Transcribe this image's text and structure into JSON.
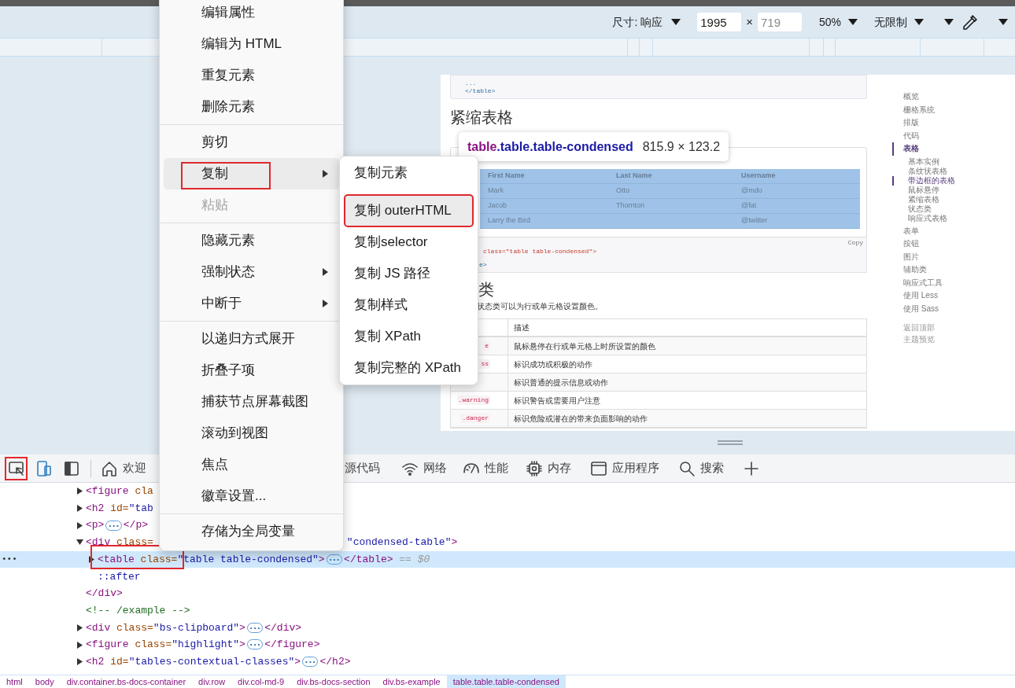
{
  "device_toolbar": {
    "dimensions": "尺寸: 响应",
    "width_value": "1995",
    "times": "×",
    "height_placeholder": "719",
    "zoom": "50%",
    "throttling": "无限制"
  },
  "page": {
    "code_tail": [
      "...",
      "</table>"
    ],
    "heading": "紧缩表格",
    "example_table": {
      "columns": [
        "First Name",
        "Last Name",
        "Username"
      ],
      "rows": [
        {
          "first_name": "Mark",
          "last_name": "Otto",
          "username": "@mdo"
        },
        {
          "first_name": "Jacob",
          "last_name": "Thornton",
          "username": "@fat"
        },
        {
          "first_name": "Larry the Bird",
          "username": "@twitter"
        }
      ]
    },
    "code_snippet": [
      "class=\"table table-condensed\">",
      "e>"
    ],
    "copy_link": "Copy",
    "heading_2": "类",
    "paragraph": "状态类可以为行或单元格设置颜色。",
    "contextual_table": {
      "columns": [
        "描述"
      ],
      "rows": [
        {
          "class": "e",
          "description": "鼠标悬停在行或单元格上时所设置的颜色"
        },
        {
          "class": "ss",
          "description": "标识成功或积极的动作"
        },
        {
          "description": "标识普通的提示信息或动作"
        },
        {
          "class": ".warning",
          "description": "标识警告或需要用户注意"
        },
        {
          "class": ".danger",
          "description": "标识危险或潜在的带来负面影响的动作"
        }
      ]
    }
  },
  "side_nav": {
    "items": [
      {
        "label": "概览",
        "selected": false
      },
      {
        "label": "栅格系统",
        "selected": false
      },
      {
        "label": "排版",
        "selected": false
      },
      {
        "label": "代码",
        "selected": false
      },
      {
        "label": "表格",
        "selected": true,
        "children": [
          {
            "label": "基本实例",
            "selected": false
          },
          {
            "label": "条纹状表格",
            "selected": false
          },
          {
            "label": "带边框的表格",
            "selected": true
          },
          {
            "label": "鼠标悬停",
            "selected": false
          },
          {
            "label": "紧缩表格",
            "selected": false
          },
          {
            "label": "状态类",
            "selected": false
          },
          {
            "label": "响应式表格",
            "selected": false
          }
        ]
      },
      {
        "label": "表单",
        "selected": false
      },
      {
        "label": "按钮",
        "selected": false
      },
      {
        "label": "图片",
        "selected": false
      },
      {
        "label": "辅助类",
        "selected": false
      },
      {
        "label": "响应式工具",
        "selected": false
      },
      {
        "label": "使用 Less",
        "selected": false
      },
      {
        "label": "使用 Sass",
        "selected": false
      }
    ],
    "footer_links": [
      "返回顶部",
      "主题预览"
    ]
  },
  "element_tooltip": {
    "tag": "table",
    "classes": ".table.table-condensed",
    "size": "815.9 × 123.2"
  },
  "devtools": {
    "tools": [
      {
        "annotated": true
      },
      {
        "annotated": false
      },
      {
        "annotated": false
      }
    ],
    "tabs": [
      {
        "label": "欢迎"
      },
      {
        "label": "源代码"
      },
      {
        "label": "网络"
      },
      {
        "label": "性能"
      },
      {
        "label": "内存"
      },
      {
        "label": "应用程序"
      },
      {
        "label": "搜索"
      }
    ],
    "dom_tree": [
      {
        "expanded": false,
        "selected": false,
        "annotated": false,
        "tokens": [
          {
            "kind": "tag",
            "text": "<figure"
          },
          {
            "kind": "attr",
            "text": " cla"
          }
        ]
      },
      {
        "expanded": false,
        "selected": false,
        "annotated": false,
        "tokens": [
          {
            "kind": "tag",
            "text": "<h2"
          },
          {
            "kind": "attr",
            "text": " id="
          },
          {
            "kind": "value",
            "text": "\"tab"
          }
        ]
      },
      {
        "expanded": false,
        "selected": false,
        "annotated": false,
        "tokens": [
          {
            "kind": "tag",
            "text": "<p>"
          },
          {
            "kind": "ellipsis",
            "text": "•••"
          },
          {
            "kind": "tag",
            "text": "</p>"
          }
        ]
      },
      {
        "expanded": true,
        "selected": false,
        "annotated": false,
        "tokens": [
          {
            "kind": "tag",
            "text": "<div"
          },
          {
            "kind": "attr",
            "text": " class="
          },
          {
            "kind": "gap"
          },
          {
            "kind": "value",
            "text": "\"condensed-table\""
          },
          {
            "kind": "tag",
            "text": ">"
          }
        ],
        "children": [
          {
            "expanded": false,
            "selected": true,
            "annotated": true,
            "gutter": "•••",
            "tokens": [
              {
                "kind": "tag",
                "text": "<table"
              },
              {
                "kind": "attr",
                "text": " class="
              },
              {
                "kind": "value",
                "text": "\"table table-condensed\""
              },
              {
                "kind": "tag",
                "text": ">"
              },
              {
                "kind": "ellipsis",
                "text": "•••"
              },
              {
                "kind": "tag",
                "text": "</table>"
              },
              {
                "kind": "note",
                "text": " == $0"
              }
            ]
          },
          {
            "selected": false,
            "annotated": false,
            "tokens": [
              {
                "kind": "pseudo",
                "text": "::after"
              }
            ]
          }
        ]
      },
      {
        "selected": false,
        "annotated": false,
        "tokens": [
          {
            "kind": "tag",
            "text": "</div>"
          }
        ]
      },
      {
        "selected": false,
        "annotated": false,
        "tokens": [
          {
            "kind": "comment",
            "text": "<!-- /example -->"
          }
        ]
      },
      {
        "expanded": false,
        "selected": false,
        "annotated": false,
        "tokens": [
          {
            "kind": "tag",
            "text": "<div"
          },
          {
            "kind": "attr",
            "text": " class="
          },
          {
            "kind": "value",
            "text": "\"bs-clipboard\""
          },
          {
            "kind": "tag",
            "text": ">"
          },
          {
            "kind": "ellipsis",
            "text": "•••"
          },
          {
            "kind": "tag",
            "text": "</div>"
          }
        ]
      },
      {
        "expanded": false,
        "selected": false,
        "annotated": false,
        "tokens": [
          {
            "kind": "tag",
            "text": "<figure"
          },
          {
            "kind": "attr",
            "text": " class="
          },
          {
            "kind": "value",
            "text": "\"highlight\""
          },
          {
            "kind": "tag",
            "text": ">"
          },
          {
            "kind": "ellipsis",
            "text": "•••"
          },
          {
            "kind": "tag",
            "text": "</figure>"
          }
        ]
      },
      {
        "expanded": false,
        "selected": false,
        "annotated": false,
        "tokens": [
          {
            "kind": "tag",
            "text": "<h2"
          },
          {
            "kind": "attr",
            "text": " id="
          },
          {
            "kind": "value",
            "text": "\"tables-contextual-classes\""
          },
          {
            "kind": "tag",
            "text": ">"
          },
          {
            "kind": "ellipsis",
            "text": "•••"
          },
          {
            "kind": "tag",
            "text": "</h2>"
          }
        ]
      }
    ],
    "breadcrumbs": [
      {
        "label": "html",
        "selected": false
      },
      {
        "label": "body",
        "selected": false
      },
      {
        "label": "div.container.bs-docs-container",
        "selected": false
      },
      {
        "label": "div.row",
        "selected": false
      },
      {
        "label": "div.col-md-9",
        "selected": false
      },
      {
        "label": "div.bs-docs-section",
        "selected": false
      },
      {
        "label": "div.bs-example",
        "selected": false
      },
      {
        "label": "table.table.table-condensed",
        "selected": true
      }
    ]
  },
  "context_menu": {
    "items": [
      {
        "kind": "item",
        "label": "编辑属性",
        "submenu": false,
        "disabled": false,
        "selected": false,
        "annotated": false
      },
      {
        "kind": "item",
        "label": "编辑为 HTML",
        "submenu": false,
        "disabled": false,
        "selected": false,
        "annotated": false
      },
      {
        "kind": "item",
        "label": "重复元素",
        "submenu": false,
        "disabled": false,
        "selected": false,
        "annotated": false
      },
      {
        "kind": "item",
        "label": "删除元素",
        "submenu": false,
        "disabled": false,
        "selected": false,
        "annotated": false
      },
      {
        "kind": "separator"
      },
      {
        "kind": "item",
        "label": "剪切",
        "submenu": false,
        "disabled": false,
        "selected": false,
        "annotated": false
      },
      {
        "kind": "item",
        "label": "复制",
        "submenu": true,
        "disabled": false,
        "selected": true,
        "annotated": true
      },
      {
        "kind": "item",
        "label": "粘贴",
        "submenu": false,
        "disabled": true,
        "selected": false,
        "annotated": false
      },
      {
        "kind": "separator"
      },
      {
        "kind": "item",
        "label": "隐藏元素",
        "submenu": false,
        "disabled": false,
        "selected": false,
        "annotated": false
      },
      {
        "kind": "item",
        "label": "强制状态",
        "submenu": true,
        "disabled": false,
        "selected": false,
        "annotated": false
      },
      {
        "kind": "item",
        "label": "中断于",
        "submenu": true,
        "disabled": false,
        "selected": false,
        "annotated": false
      },
      {
        "kind": "separator"
      },
      {
        "kind": "item",
        "label": "以递归方式展开",
        "submenu": false,
        "disabled": false,
        "selected": false,
        "annotated": false
      },
      {
        "kind": "item",
        "label": "折叠子项",
        "submenu": false,
        "disabled": false,
        "selected": false,
        "annotated": false
      },
      {
        "kind": "item",
        "label": "捕获节点屏幕截图",
        "submenu": false,
        "disabled": false,
        "selected": false,
        "annotated": false
      },
      {
        "kind": "item",
        "label": "滚动到视图",
        "submenu": false,
        "disabled": false,
        "selected": false,
        "annotated": false
      },
      {
        "kind": "item",
        "label": "焦点",
        "submenu": false,
        "disabled": false,
        "selected": false,
        "annotated": false
      },
      {
        "kind": "item",
        "label": "徽章设置...",
        "submenu": false,
        "disabled": false,
        "selected": false,
        "annotated": false
      },
      {
        "kind": "separator"
      },
      {
        "kind": "item",
        "label": "存储为全局变量",
        "submenu": false,
        "disabled": false,
        "selected": false,
        "annotated": false
      }
    ]
  },
  "copy_submenu": {
    "items": [
      {
        "label": "复制元素",
        "selected": false,
        "annotated": false
      },
      {
        "label": "复制 outerHTML",
        "selected": true,
        "annotated": true
      },
      {
        "label": "复制selector",
        "selected": false,
        "annotated": false
      },
      {
        "label": "复制 JS 路径",
        "selected": false,
        "annotated": false
      },
      {
        "label": "复制样式",
        "selected": false,
        "annotated": false
      },
      {
        "label": "复制 XPath",
        "selected": false,
        "annotated": false
      },
      {
        "label": "复制完整的 XPath",
        "selected": false,
        "annotated": false
      }
    ]
  }
}
